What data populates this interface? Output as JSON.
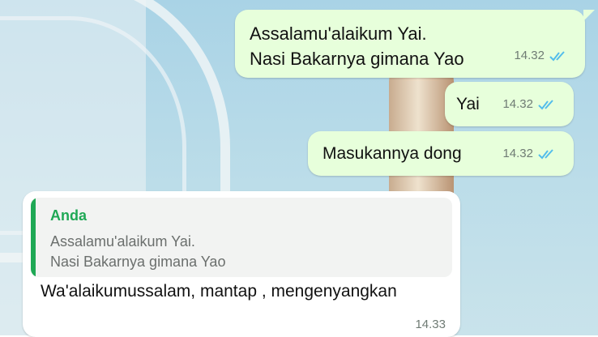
{
  "messages": [
    {
      "text": "Assalamu'alaikum Yai.\nNasi Bakarnya gimana Yao",
      "time": "14.32",
      "status": "read"
    },
    {
      "text": "Yai",
      "time": "14.32",
      "status": "read"
    },
    {
      "text": "Masukannya dong",
      "time": "14.32",
      "status": "read"
    }
  ],
  "reply": {
    "quoted_author": "Anda",
    "quoted_text": "Assalamu'alaikum Yai.\nNasi Bakarnya gimana Yao",
    "text": "Wa'alaikumussalam, mantap , mengenyangkan",
    "time": "14.33"
  },
  "colors": {
    "outgoing_bubble": "#e7ffdb",
    "incoming_bubble": "#ffffff",
    "read_ticks": "#53bdeb",
    "quote_accent": "#1fa855"
  },
  "icons": {
    "read_status": "double-check-icon"
  }
}
